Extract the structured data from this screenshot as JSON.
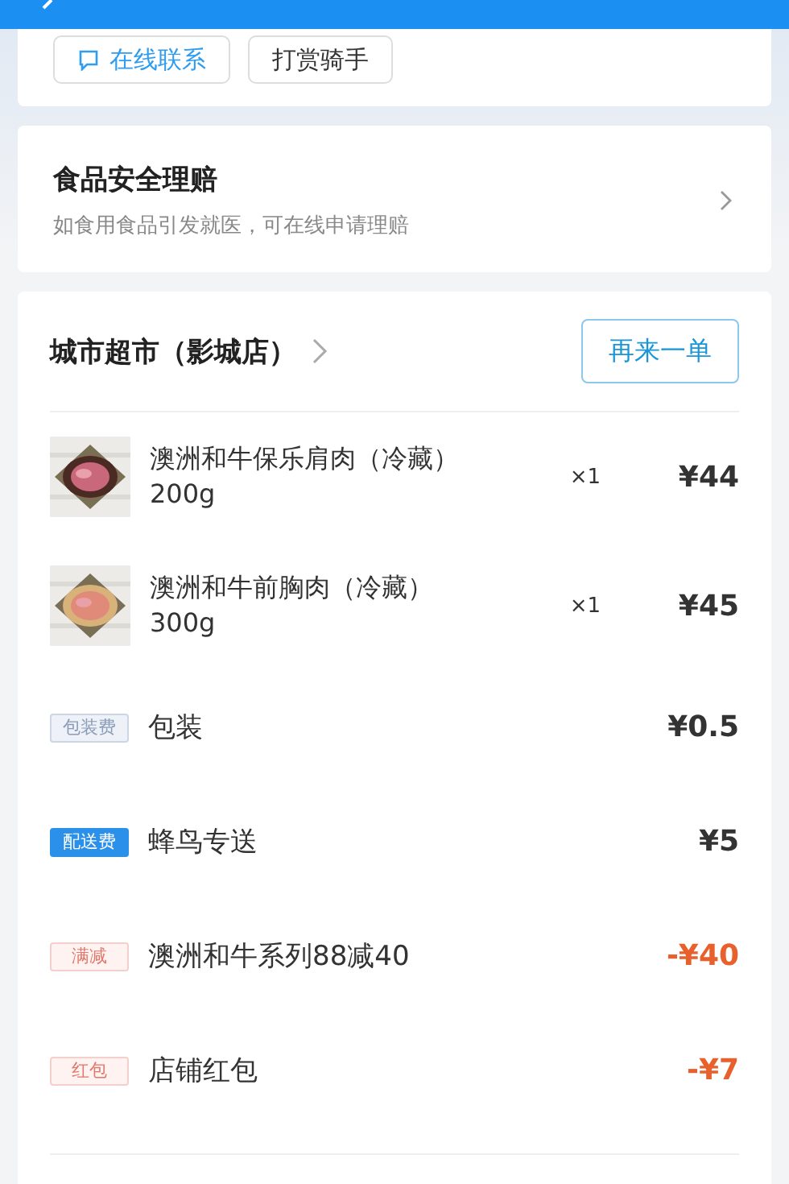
{
  "contact_buttons": [
    {
      "label": "在线联系",
      "kind": "chat"
    },
    {
      "label": "打赏骑手",
      "kind": "plain"
    }
  ],
  "insurance": {
    "title": "食品安全理赔",
    "subtitle": "如食用食品引发就医，可在线申请理赔"
  },
  "store": {
    "name": "城市超市（影城店）",
    "reorder_button": "再来一单"
  },
  "products": [
    {
      "name": "澳洲和牛保乐肩肉（冷藏）200g",
      "quantity": "×1",
      "price": "¥44",
      "kind": "picture"
    },
    {
      "name": "澳洲和牛前胸肉（冷藏）300g",
      "quantity": "×1",
      "price": "¥45",
      "kind": "picture"
    }
  ],
  "fees": [
    {
      "tag": "包装费",
      "kind": "packaging",
      "label": "包装",
      "amount": "¥0.5"
    },
    {
      "tag": "配送费",
      "kind": "delivery",
      "label": "蜂鸟专送",
      "amount": "¥5"
    },
    {
      "tag": "满减",
      "kind": "discount",
      "label": "澳洲和牛系列88减40",
      "amount": "-¥40"
    },
    {
      "tag": "红包",
      "kind": "discount",
      "label": "店铺红包",
      "amount": "-¥7"
    }
  ]
}
